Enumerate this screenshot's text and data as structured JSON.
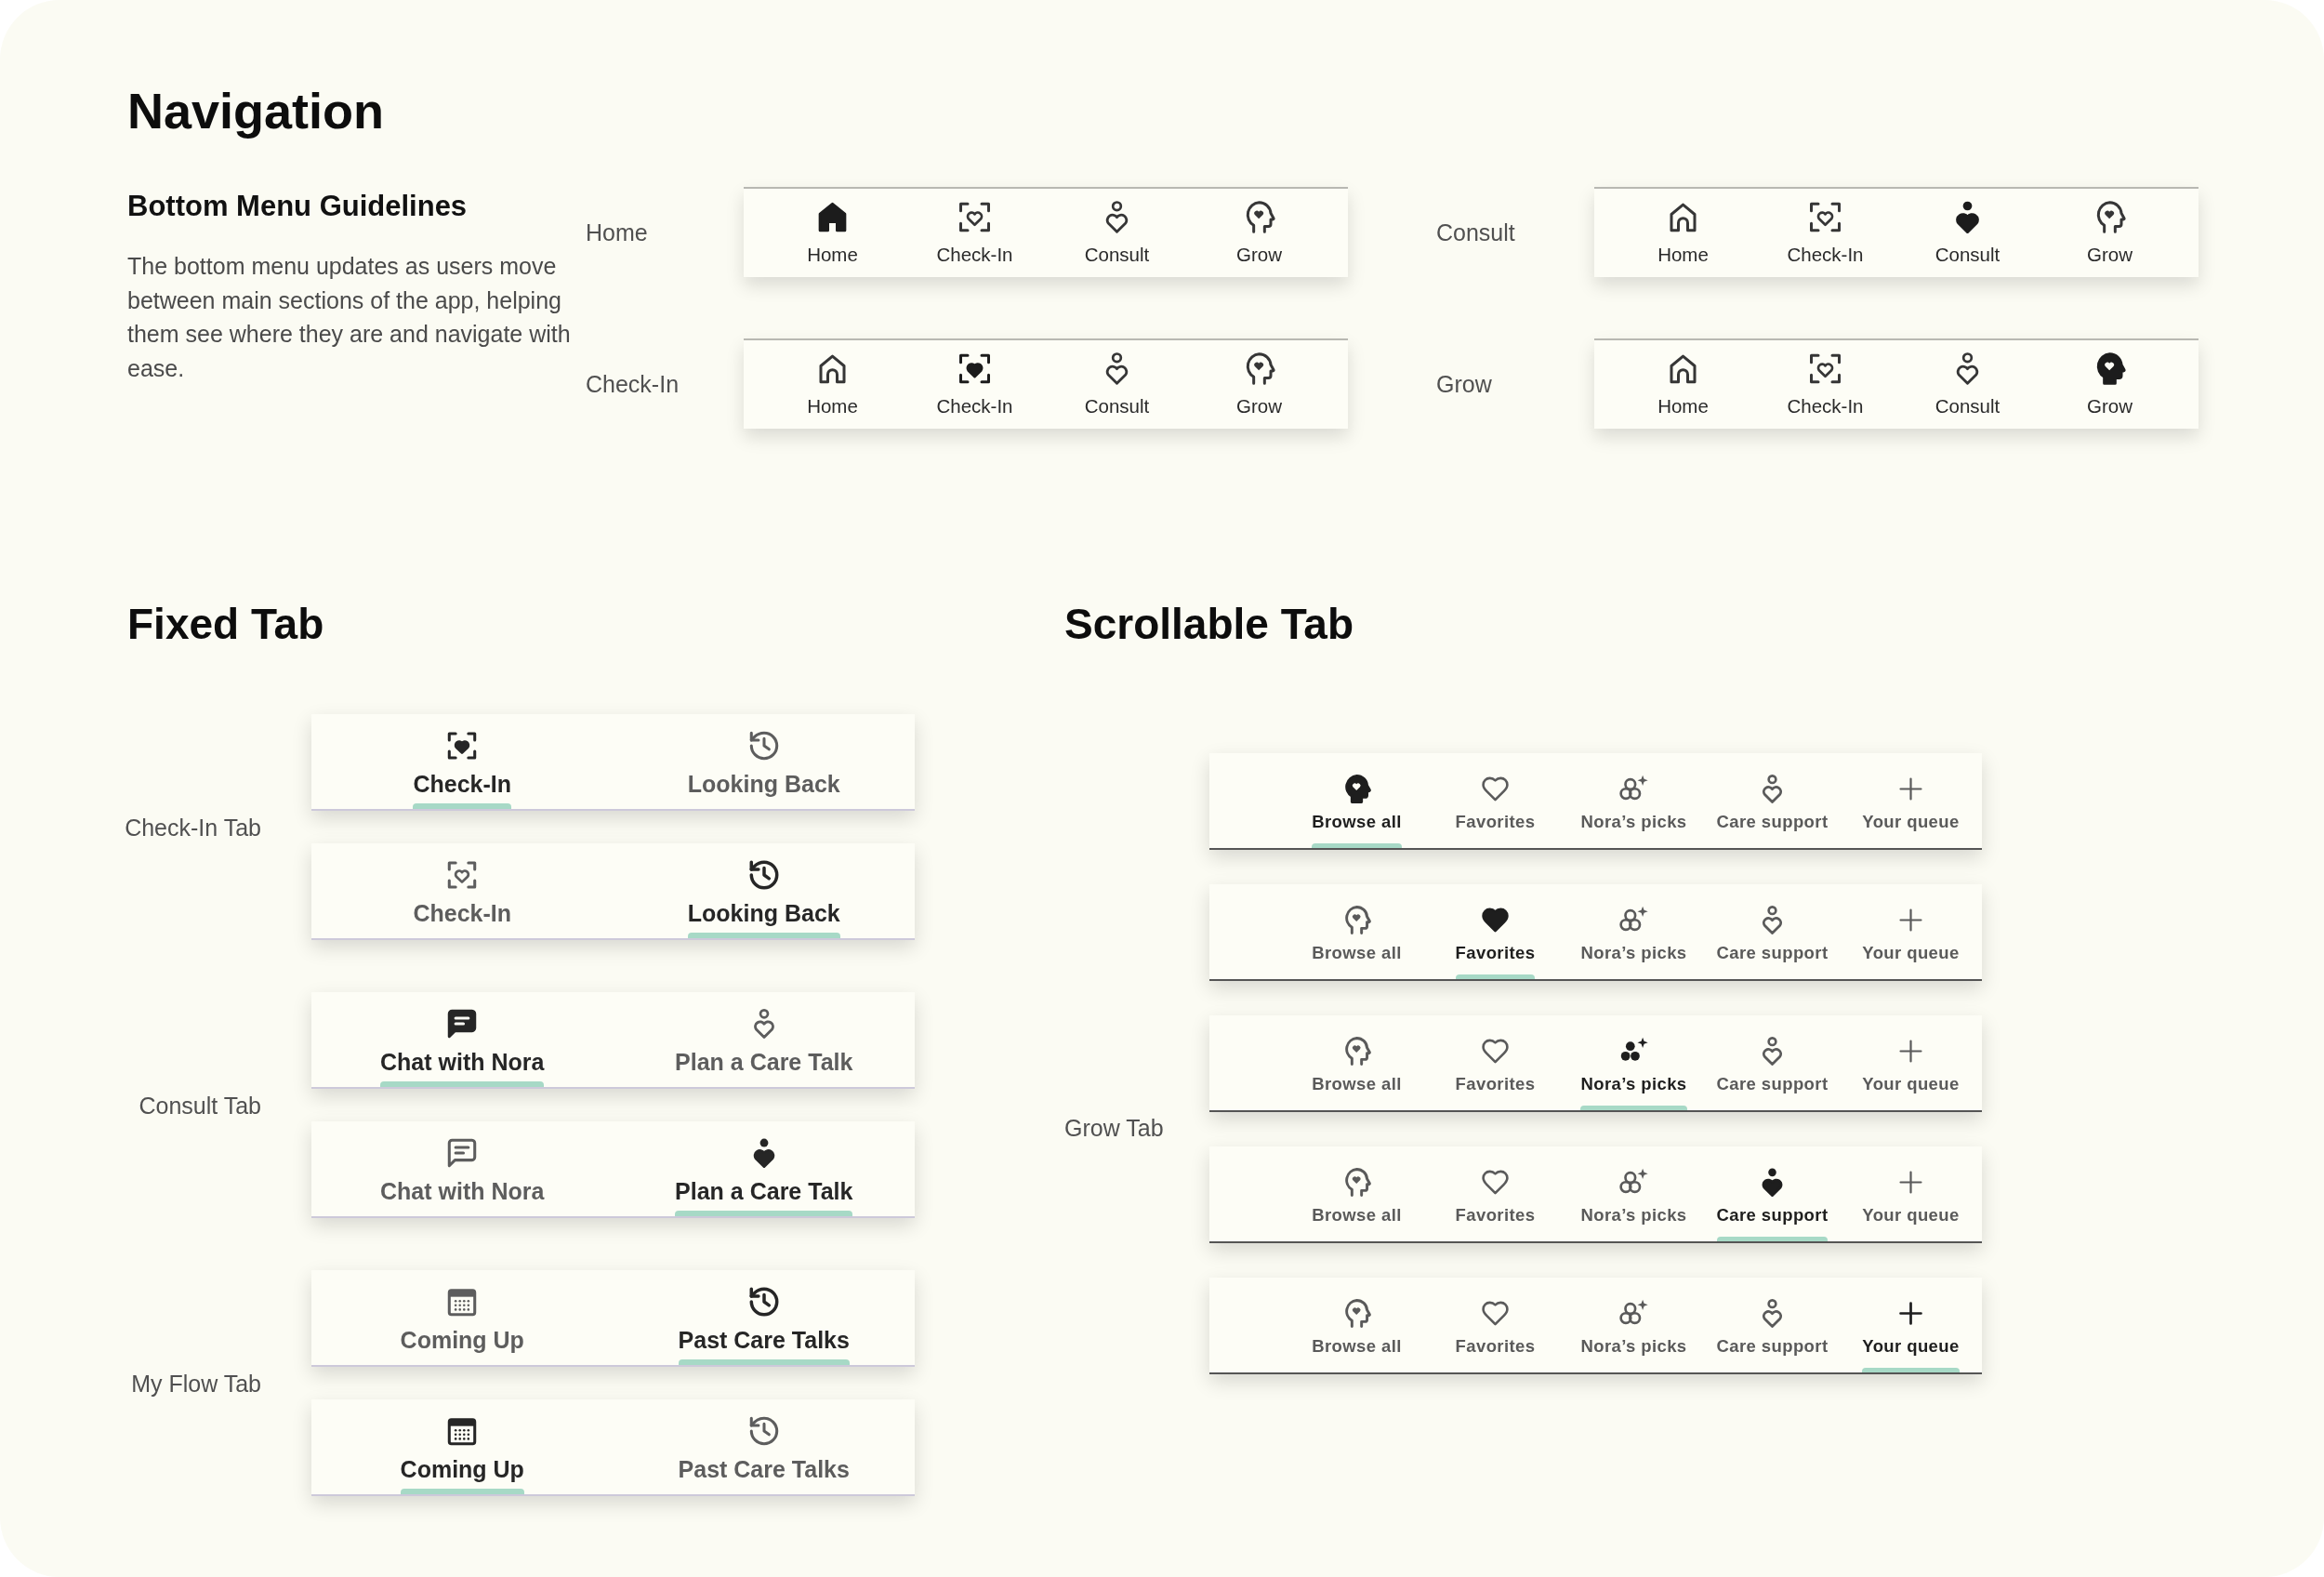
{
  "navigation": {
    "title": "Navigation",
    "guidelines": {
      "title": "Bottom Menu Guidelines",
      "text": "The bottom menu updates as users move between main sections of the app, helping them see where they are and navigate with ease."
    },
    "menus": [
      {
        "label": "Home",
        "items": [
          {
            "label": "Home",
            "selected": true
          },
          {
            "label": "Check-In",
            "selected": false
          },
          {
            "label": "Consult",
            "selected": false
          },
          {
            "label": "Grow",
            "selected": false
          }
        ]
      },
      {
        "label": "Consult",
        "items": [
          {
            "label": "Home",
            "selected": false
          },
          {
            "label": "Check-In",
            "selected": false
          },
          {
            "label": "Consult",
            "selected": true
          },
          {
            "label": "Grow",
            "selected": false
          }
        ]
      },
      {
        "label": "Check-In",
        "items": [
          {
            "label": "Home",
            "selected": false
          },
          {
            "label": "Check-In",
            "selected": true
          },
          {
            "label": "Consult",
            "selected": false
          },
          {
            "label": "Grow",
            "selected": false
          }
        ]
      },
      {
        "label": "Grow",
        "items": [
          {
            "label": "Home",
            "selected": false
          },
          {
            "label": "Check-In",
            "selected": false
          },
          {
            "label": "Consult",
            "selected": false
          },
          {
            "label": "Grow",
            "selected": true
          }
        ]
      }
    ]
  },
  "fixed_tab": {
    "title": "Fixed Tab",
    "groups": [
      {
        "label": "Check-In Tab",
        "bars": [
          {
            "tabs": [
              {
                "label": "Check-In",
                "selected": true
              },
              {
                "label": "Looking Back",
                "selected": false
              }
            ]
          },
          {
            "tabs": [
              {
                "label": "Check-In",
                "selected": false
              },
              {
                "label": "Looking Back",
                "selected": true
              }
            ]
          }
        ]
      },
      {
        "label": "Consult Tab",
        "bars": [
          {
            "tabs": [
              {
                "label": "Chat with Nora",
                "selected": true
              },
              {
                "label": "Plan a Care Talk",
                "selected": false
              }
            ]
          },
          {
            "tabs": [
              {
                "label": "Chat with Nora",
                "selected": false
              },
              {
                "label": "Plan a Care Talk",
                "selected": true
              }
            ]
          }
        ]
      },
      {
        "label": "My Flow Tab",
        "bars": [
          {
            "tabs": [
              {
                "label": "Coming Up",
                "selected": false
              },
              {
                "label": "Past Care Talks",
                "selected": true
              }
            ]
          },
          {
            "tabs": [
              {
                "label": "Coming Up",
                "selected": true
              },
              {
                "label": "Past Care Talks",
                "selected": false
              }
            ]
          }
        ]
      }
    ]
  },
  "scrollable_tab": {
    "title": "Scrollable Tab",
    "label": "Grow Tab",
    "bars": [
      {
        "tabs": [
          {
            "label": "Browse all",
            "selected": true
          },
          {
            "label": "Favorites",
            "selected": false
          },
          {
            "label": "Nora’s picks",
            "selected": false
          },
          {
            "label": "Care support",
            "selected": false
          },
          {
            "label": "Your queue",
            "selected": false
          }
        ]
      },
      {
        "tabs": [
          {
            "label": "Browse all",
            "selected": false
          },
          {
            "label": "Favorites",
            "selected": true
          },
          {
            "label": "Nora’s picks",
            "selected": false
          },
          {
            "label": "Care support",
            "selected": false
          },
          {
            "label": "Your queue",
            "selected": false
          }
        ]
      },
      {
        "tabs": [
          {
            "label": "Browse all",
            "selected": false
          },
          {
            "label": "Favorites",
            "selected": false
          },
          {
            "label": "Nora’s picks",
            "selected": true
          },
          {
            "label": "Care support",
            "selected": false
          },
          {
            "label": "Your queue",
            "selected": false
          }
        ]
      },
      {
        "tabs": [
          {
            "label": "Browse all",
            "selected": false
          },
          {
            "label": "Favorites",
            "selected": false
          },
          {
            "label": "Nora’s picks",
            "selected": false
          },
          {
            "label": "Care support",
            "selected": true
          },
          {
            "label": "Your queue",
            "selected": false
          }
        ]
      },
      {
        "tabs": [
          {
            "label": "Browse all",
            "selected": false
          },
          {
            "label": "Favorites",
            "selected": false
          },
          {
            "label": "Nora’s picks",
            "selected": false
          },
          {
            "label": "Care support",
            "selected": false
          },
          {
            "label": "Your queue",
            "selected": true
          }
        ]
      }
    ]
  }
}
